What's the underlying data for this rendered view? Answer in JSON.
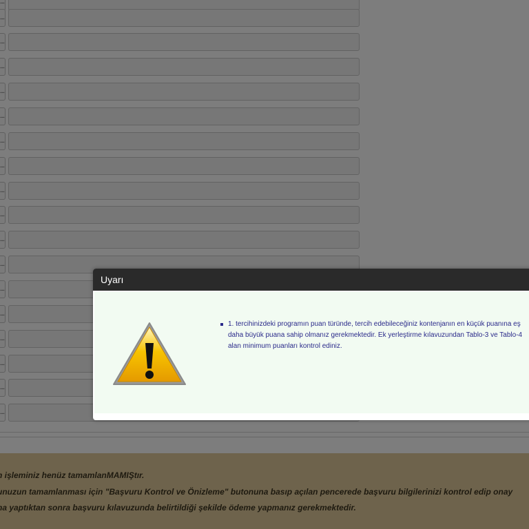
{
  "background_rows": {
    "row_button_label": "..."
  },
  "dialog": {
    "title": "Uyarı",
    "icon": "warning-icon",
    "message_lines": [
      "1. tercihinizdeki programın puan türünde, tercih edebileceğiniz kontenjanın en küçük puanına eş",
      "daha büyük puana sahip olmanız gerekmektedir. Ek yerleştirme kılavuzundan Tablo-3 ve Tablo-4",
      "alan minimum puanları kontrol ediniz."
    ]
  },
  "footer": {
    "lines": [
      "n işleminiz henüz tamamlanMAMIŞtır.",
      "unuzun tamamlanması için \"Başvuru Kontrol ve Önizleme\" butonuna basıp açılan pencerede başvuru bilgilerinizi kontrol edip onay",
      "na yaptıktan sonra başvuru kılavuzunda belirtildiği şekilde ödeme yapmanız gerekmektedir."
    ]
  },
  "colors": {
    "overlay": "#7d7d7d",
    "dialog_header": "#2a2a2a",
    "dialog_body": "#f2fbf2",
    "message_text": "#2a2a8a",
    "footer_bg": "#6e634c"
  }
}
